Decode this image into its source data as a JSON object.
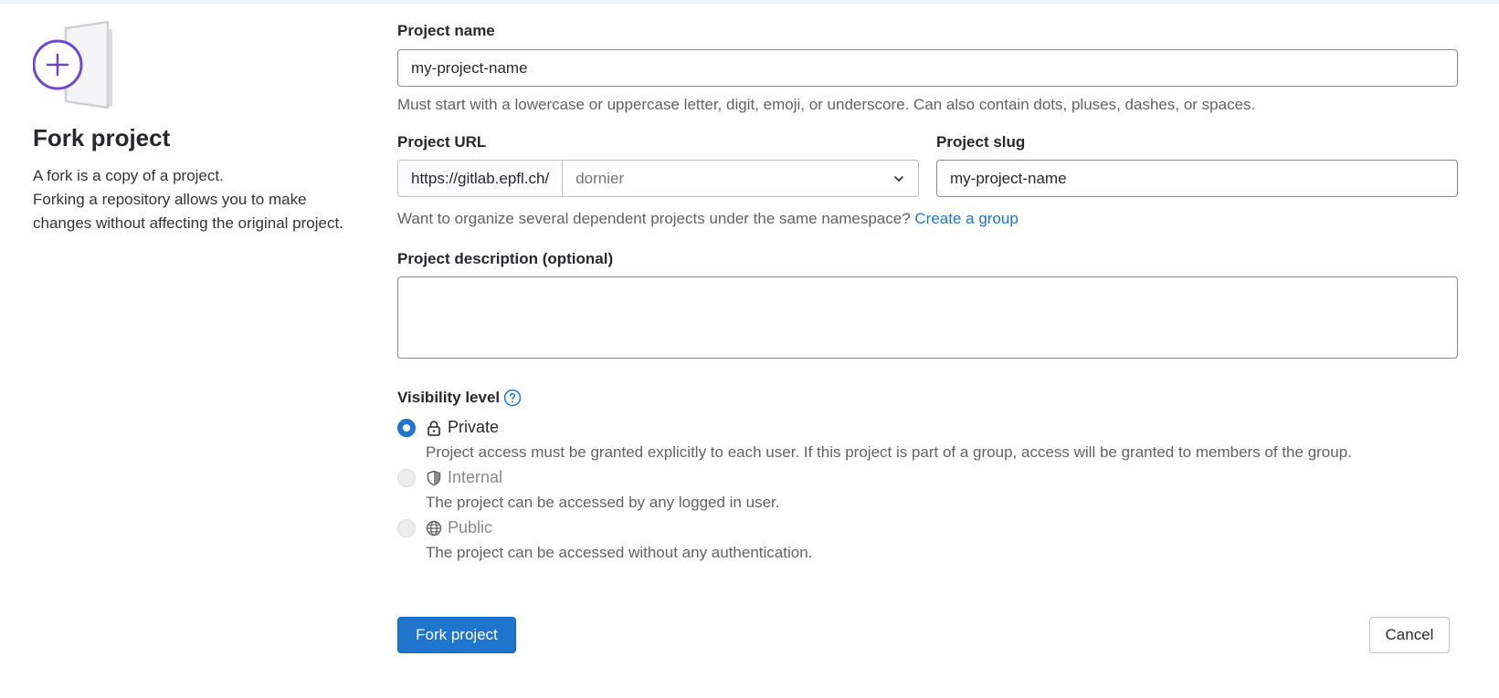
{
  "sidebar": {
    "title": "Fork project",
    "line1": "A fork is a copy of a project.",
    "line2": "Forking a repository allows you to make changes without affecting the original project."
  },
  "form": {
    "project_name": {
      "label": "Project name",
      "value": "my-project-name",
      "help": "Must start with a lowercase or uppercase letter, digit, emoji, or underscore. Can also contain dots, pluses, dashes, or spaces."
    },
    "project_url": {
      "label": "Project URL",
      "prefix": "https://gitlab.epfl.ch/",
      "namespace": "dornier"
    },
    "project_slug": {
      "label": "Project slug",
      "value": "my-project-name"
    },
    "namespace_help": {
      "text": "Want to organize several dependent projects under the same namespace?",
      "link": "Create a group"
    },
    "description": {
      "label": "Project description (optional)",
      "value": ""
    },
    "visibility": {
      "label": "Visibility level",
      "options": [
        {
          "label": "Private",
          "description": "Project access must be granted explicitly to each user. If this project is part of a group, access will be granted to members of the group.",
          "checked": true,
          "icon": "lock-icon"
        },
        {
          "label": "Internal",
          "description": "The project can be accessed by any logged in user.",
          "checked": false,
          "icon": "shield-icon"
        },
        {
          "label": "Public",
          "description": "The project can be accessed without any authentication.",
          "checked": false,
          "icon": "globe-icon"
        }
      ]
    }
  },
  "actions": {
    "submit": "Fork project",
    "cancel": "Cancel"
  },
  "colors": {
    "primary": "#1f75cb",
    "accent_purple": "#6e49cb"
  }
}
